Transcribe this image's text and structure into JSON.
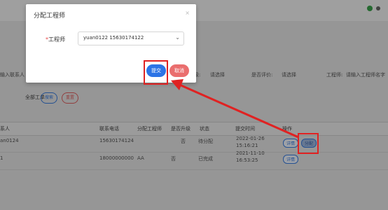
{
  "modal": {
    "title": "分配工程师",
    "close_glyph": "×",
    "field_label": "工程师",
    "required_mark": "*",
    "select_value": "yuan0122   15630174122",
    "submit_label": "提交",
    "cancel_label": "取消"
  },
  "filters": {
    "name_placeholder": "输入联系人",
    "upgrade_label": "是否升级:",
    "upgrade_value": "请选择",
    "eval_label": "是否评价:",
    "eval_value": "请选择",
    "engineer_label": "工程师:",
    "engineer_placeholder": "请输入工程师名字",
    "all_orders": "全部工单",
    "search_btn": "搜索",
    "reset_btn": "重置"
  },
  "table": {
    "headers": [
      "系人",
      "联系电话",
      "分配工程师",
      "是否升级",
      "状态",
      "提交时间",
      "操作"
    ],
    "rows": [
      {
        "contact": "an0124",
        "phone": "15630174124",
        "engineer": "",
        "upgrade": "否",
        "status": "待分配",
        "time1": "2022-01-26",
        "time2": "15:16:21",
        "detail": "详情",
        "assign": "分配"
      },
      {
        "contact": "1",
        "phone": "18000000000",
        "engineer": "AA",
        "upgrade": "否",
        "status": "已完成",
        "time1": "2021-11-10",
        "time2": "16:53:25",
        "detail": "详情",
        "assign": ""
      }
    ]
  },
  "colors": {
    "primary": "#2c74e6",
    "danger": "#ea6e6e",
    "highlight": "#e02222"
  }
}
